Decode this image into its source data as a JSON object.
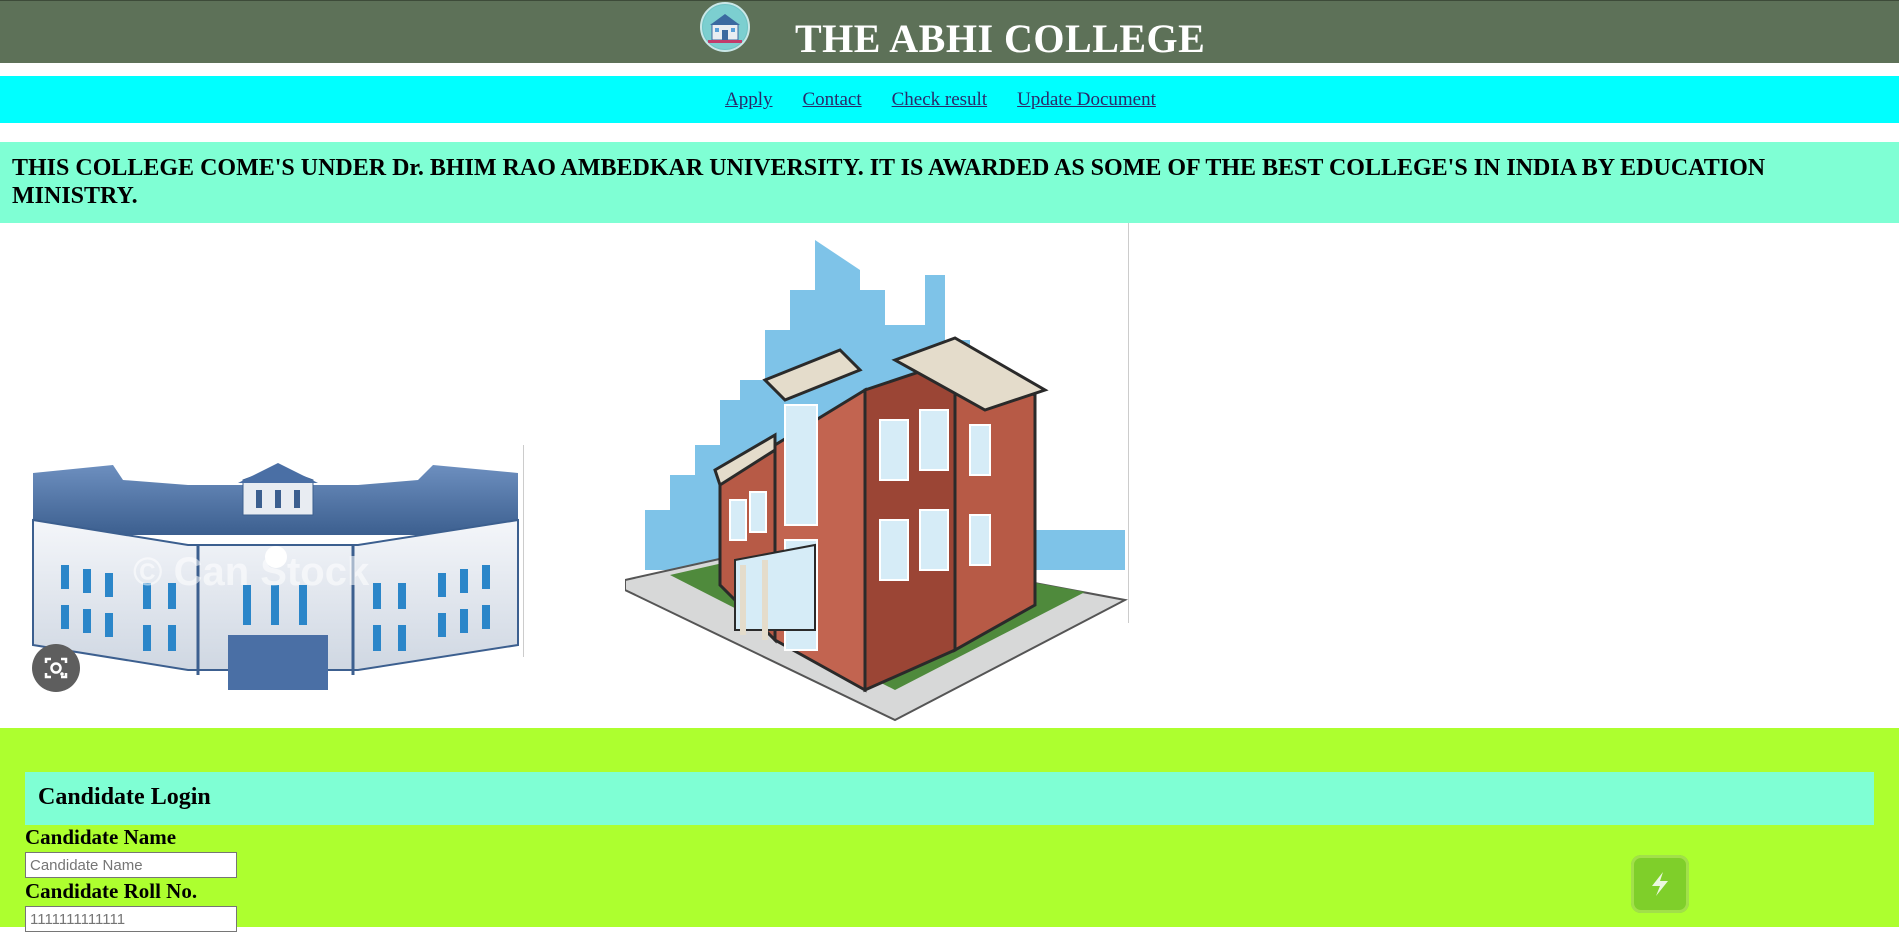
{
  "header": {
    "title": "THE ABHI COLLEGE",
    "logo_icon": "college-building-logo-icon"
  },
  "nav": {
    "links": [
      "Apply",
      "Contact",
      "Check result",
      "Update Document"
    ]
  },
  "banner": {
    "text": "THIS COLLEGE COME'S UNDER Dr. BHIM RAO AMBEDKAR UNIVERSITY. IT IS AWARDED AS SOME OF THE BEST COLLEGE'S IN INDIA BY EDUCATION MINISTRY."
  },
  "images": {
    "watermark": "© Can Stock"
  },
  "login": {
    "heading": "Candidate Login",
    "name_label": "Candidate Name",
    "name_placeholder": "Candidate Name",
    "roll_label": "Candidate Roll No.",
    "roll_placeholder": "1111111111111"
  },
  "colors": {
    "header_bg": "#5d7158",
    "nav_bg": "#00ffff",
    "banner_bg": "#7fffd4",
    "login_bg": "#adff2f"
  }
}
